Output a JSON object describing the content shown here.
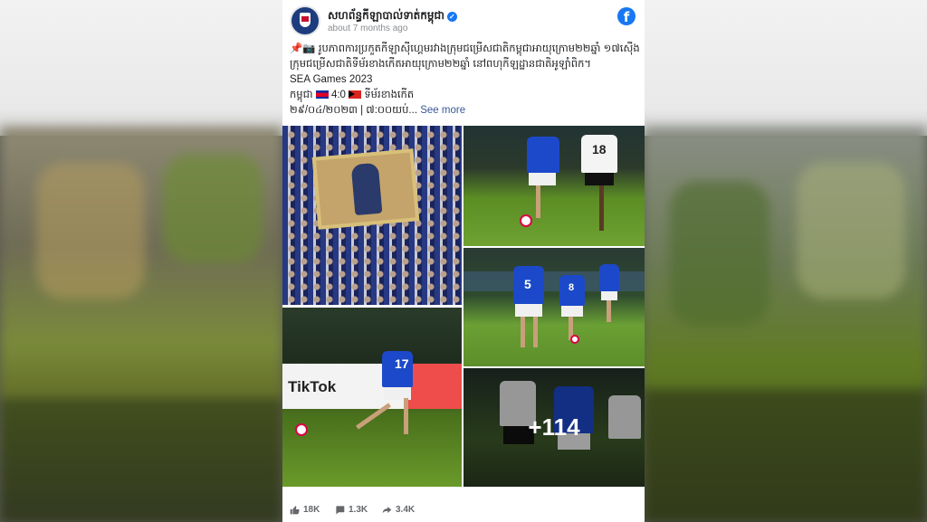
{
  "post": {
    "page_name": "សហព័ន្ធកីឡាបាល់ទាត់កម្ពុជា",
    "timestamp": "about 7 months ago",
    "body_line1": "📌📷 រូបភាពការប្រកួតកីឡាស៊ីហ្គេមរវាងក្រុមជម្រើសជាតិកម្ពុជាអាយុក្រោម២២ឆ្នាំ ១៧ស៊ើង",
    "body_line2": "ក្រុមជម្រើសជាតិទីម័រខាងកើតអាយុក្រោម២២ឆ្នាំ នៅពហុកីឡដ្ឋានជាតិអូឡាំពិក។",
    "event_title": "SEA Games 2023",
    "score_left": "កម្ពុជា",
    "score": "4:0",
    "score_right": "ទីម័រខាងកើត",
    "date_time": "២៩/០៤/២០២៣ | ៧:០០យប់...",
    "see_more": "See more"
  },
  "photos": {
    "p2_sponsor": "TikTok",
    "p3_jersey": "18",
    "p4_jersey1": "5",
    "p4_jersey2": "8",
    "p2_jersey": "17",
    "more_count": "+114"
  },
  "reactions": {
    "likes": "18K",
    "comments": "1.3K",
    "shares": "3.4K"
  },
  "colors": {
    "facebook_blue": "#1877f2",
    "link": "#385898"
  },
  "icons": [
    "facebook-logo-icon",
    "verified-badge-icon",
    "like-icon",
    "comment-icon",
    "share-icon"
  ]
}
